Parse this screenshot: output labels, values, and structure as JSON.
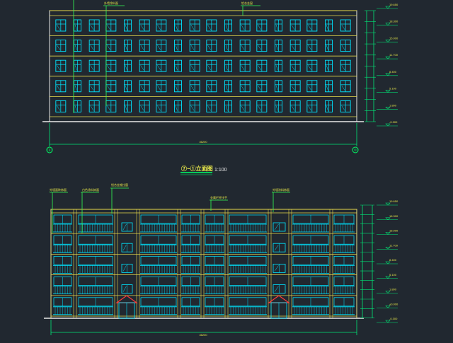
{
  "background": "#212830",
  "colors": {
    "window": "#00e5ff",
    "wall": "#e8e8e8",
    "floor_line": "#e6d84a",
    "dimension": "#00e676",
    "leader": "#33ff55",
    "label": "#e6e64a",
    "door": "#ff3b3b",
    "axis": "#00ff66"
  },
  "upper_elevation": {
    "floors": 5,
    "windows_per_floor": 18,
    "callouts": [
      "外墙涂料面",
      "铝合金窗"
    ],
    "axis_left": "Ⓐ",
    "axis_right": "①",
    "overall_dimension": "46200",
    "level_marks": [
      "19.650",
      "18.300",
      "15.000",
      "11.700",
      "8.400",
      "5.100",
      "1.800",
      "-0.300"
    ]
  },
  "title": {
    "text": "⑦~①立面图",
    "scale": "1:100"
  },
  "lower_elevation": {
    "floors": 5,
    "bays": 10,
    "callouts": [
      "外墙面砖饰面",
      "白色涂料饰面",
      "铝合金推拉窗",
      "金属栏杆扶手",
      "外墙涂料饰面"
    ],
    "overall_dimension": "46200",
    "level_marks": [
      "19.650",
      "18.300",
      "15.000",
      "11.700",
      "8.400",
      "5.100",
      "1.800",
      "±0.000",
      "-0.300"
    ]
  }
}
